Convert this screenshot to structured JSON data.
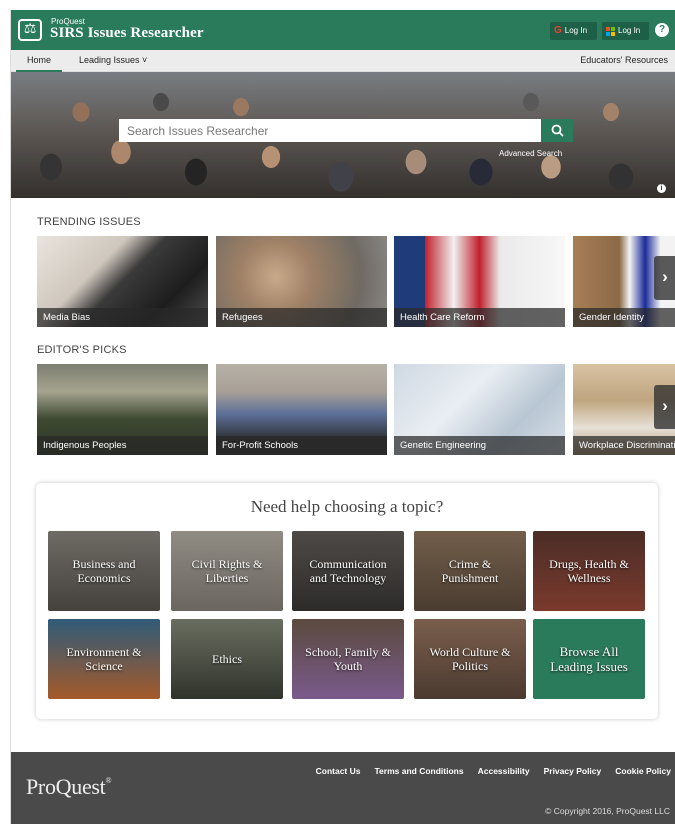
{
  "header": {
    "brand_small": "ProQuest",
    "brand_title": "SIRS Issues Researcher",
    "google_login": "Log In",
    "microsoft_login": "Log In",
    "help": "?"
  },
  "nav": {
    "home": "Home",
    "leading_issues": "Leading Issues ˅",
    "educators_resources": "Educators' Resources"
  },
  "search": {
    "placeholder": "Search Issues Researcher",
    "advanced": "Advanced Search"
  },
  "trending": {
    "title": "TRENDING ISSUES",
    "items": [
      "Media Bias",
      "Refugees",
      "Health Care Reform",
      "Gender Identity"
    ]
  },
  "editors": {
    "title": "EDITOR'S PICKS",
    "items": [
      "Indigenous Peoples",
      "For-Profit Schools",
      "Genetic Engineering",
      "Workplace Discrimination"
    ]
  },
  "help": {
    "title": "Need help choosing a topic?",
    "topics": [
      "Business and Economics",
      "Civil Rights & Liberties",
      "Communication and Technology",
      "Crime & Punishment",
      "Drugs, Health & Wellness",
      "Environment & Science",
      "Ethics",
      "School, Family & Youth",
      "World Culture & Politics",
      "Browse All Leading Issues"
    ]
  },
  "footer": {
    "logo": "ProQuest",
    "links": [
      "Contact Us",
      "Terms and Conditions",
      "Accessibility",
      "Privacy Policy",
      "Cookie Policy"
    ],
    "copyright": "© Copyright 2016, ProQuest LLC"
  },
  "colors": {
    "brand_green": "#2a7a5c",
    "footer_gray": "#4a4a4a"
  }
}
